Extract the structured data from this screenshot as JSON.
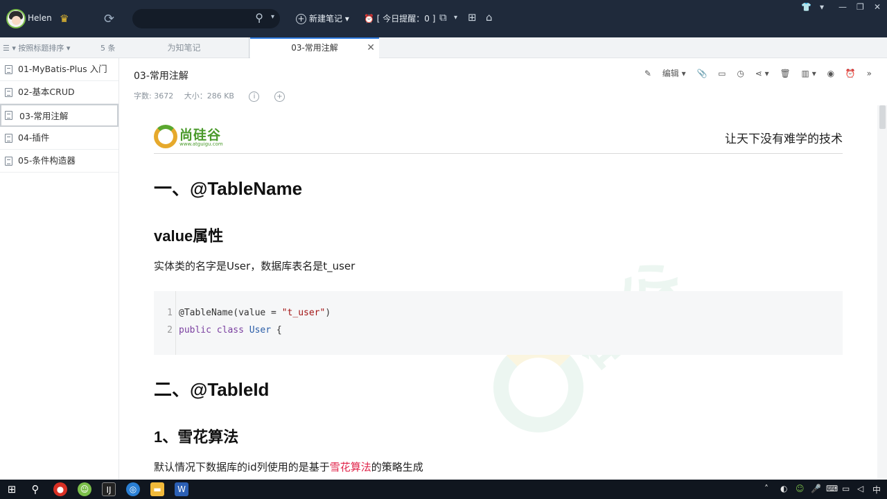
{
  "user": {
    "name": "Helen"
  },
  "topbar": {
    "new_note": "新建笔记",
    "reminder": "[ 今日提醒：0 ]"
  },
  "list": {
    "sort_label": "按照标题排序",
    "count": "5 条",
    "items": [
      {
        "label": "01-MyBatis-Plus 入门"
      },
      {
        "label": "02-基本CRUD"
      },
      {
        "label": "03-常用注解"
      },
      {
        "label": "04-插件"
      },
      {
        "label": "05-条件构造器"
      }
    ]
  },
  "tabs": [
    {
      "label": "为知笔记"
    },
    {
      "label": "03-常用注解"
    }
  ],
  "note": {
    "title": "03-常用注解",
    "word_count": "字数: 3672",
    "size": "大小：286 KB",
    "edit_label": "编辑"
  },
  "doc": {
    "logo_name": "尚硅谷",
    "logo_url": "www.atguigu.com",
    "slogan": "让天下没有难学的技术",
    "h1_a": "一、@TableName",
    "h2_a": "value属性",
    "para_a": "实体类的名字是User，数据库表名是t_user",
    "code": [
      {
        "n": "1",
        "a": "@TableName(value = ",
        "s": "\"t_user\"",
        "b": ")"
      },
      {
        "n": "2",
        "kw": "public class ",
        "cls": "User",
        "b": " {"
      }
    ],
    "h1_b": "二、@TableId",
    "h2_b": "1、雪花算法",
    "para_b_pre": "默认情况下数据库的id列使用的是基于",
    "para_b_red": "雪花算法",
    "para_b_post": "的策略生成"
  },
  "taskbar": {
    "ime": "中"
  },
  "colors": {
    "topbar": "#1f2a3b",
    "accent": "#2f7de1",
    "red": "#e0244a"
  }
}
